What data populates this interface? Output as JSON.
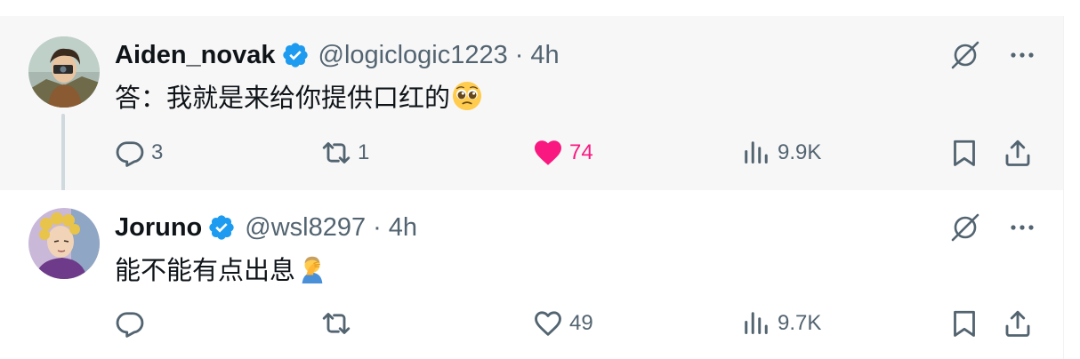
{
  "tweets": [
    {
      "display_name": "Aiden_novak",
      "handle": "@logiclogic1223",
      "separator": "·",
      "time": "4h",
      "text": "答：我就是来给你提供口红的",
      "emoji": "pleading-face",
      "verified": true,
      "actions": {
        "replies": "3",
        "reposts": "1",
        "likes": "74",
        "views": "9.9K",
        "liked": true
      }
    },
    {
      "display_name": "Joruno",
      "handle": "@wsl8297",
      "separator": "·",
      "time": "4h",
      "text": "能不能有点出息",
      "emoji": "person-facepalming",
      "verified": true,
      "actions": {
        "replies": "",
        "reposts": "",
        "likes": "49",
        "views": "9.7K",
        "liked": false
      }
    }
  ],
  "colors": {
    "verified": "#1d9bf0",
    "like_active": "#f91880",
    "secondary_text": "#536471",
    "primary_text": "#0f1419",
    "highlight_bg": "#f7f7f7"
  },
  "icons": {
    "reply": "reply-icon",
    "repost": "repost-icon",
    "like": "heart-icon",
    "views": "views-icon",
    "bookmark": "bookmark-icon",
    "share": "share-icon",
    "grok": "grok-icon",
    "more": "more-icon",
    "verified": "verified-badge-icon"
  }
}
